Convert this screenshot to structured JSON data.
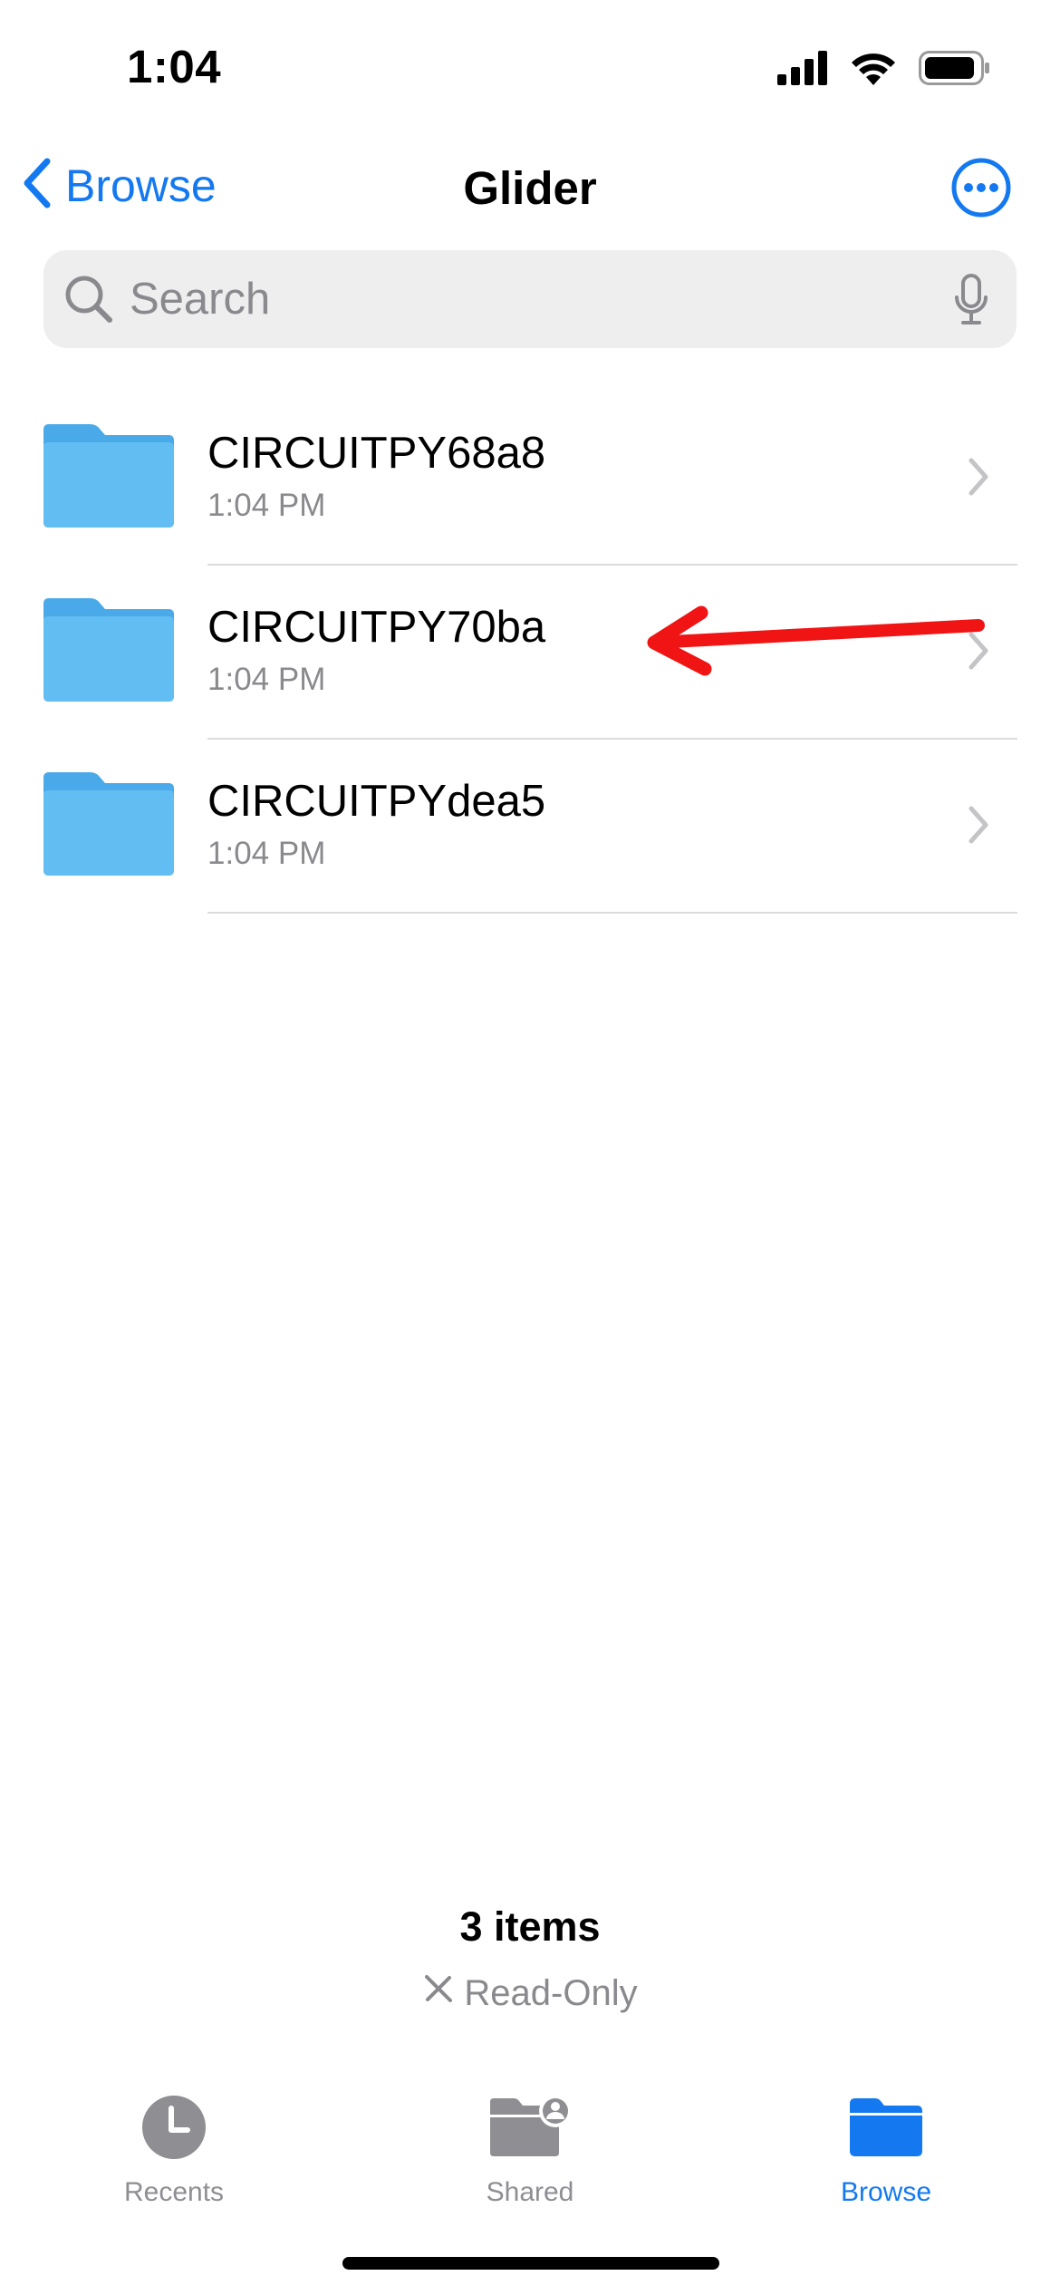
{
  "status_bar": {
    "time": "1:04"
  },
  "nav": {
    "back_label": "Browse",
    "title": "Glider"
  },
  "search": {
    "placeholder": "Search"
  },
  "files": [
    {
      "name": "CIRCUITPY68a8",
      "time": "1:04 PM",
      "icon": "folder-icon"
    },
    {
      "name": "CIRCUITPY70ba",
      "time": "1:04 PM",
      "icon": "folder-icon"
    },
    {
      "name": "CIRCUITPYdea5",
      "time": "1:04 PM",
      "icon": "folder-icon"
    }
  ],
  "footer": {
    "item_count": "3 items",
    "read_only": "Read-Only"
  },
  "tabs": [
    {
      "label": "Recents",
      "icon": "clock-icon",
      "active": false
    },
    {
      "label": "Shared",
      "icon": "shared-folder-icon",
      "active": false
    },
    {
      "label": "Browse",
      "icon": "folder-icon",
      "active": true
    }
  ],
  "colors": {
    "accent": "#1479f0",
    "folder": "#5ab4ee",
    "annotation": "#f01414",
    "secondary_text": "#8a8a8e"
  }
}
